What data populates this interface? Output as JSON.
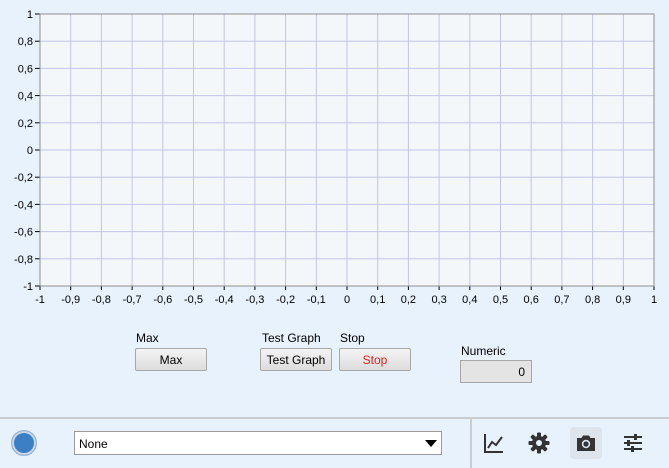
{
  "chart_data": {
    "type": "line",
    "title": "",
    "xlabel": "",
    "ylabel": "",
    "xlim": [
      -1,
      1
    ],
    "ylim": [
      -1,
      1
    ],
    "grid": true,
    "x_ticks": [
      "-1",
      "-0,9",
      "-0,8",
      "-0,7",
      "-0,6",
      "-0,5",
      "-0,4",
      "-0,3",
      "-0,2",
      "-0,1",
      "0",
      "0,1",
      "0,2",
      "0,3",
      "0,4",
      "0,5",
      "0,6",
      "0,7",
      "0,8",
      "0,9",
      "1"
    ],
    "y_ticks": [
      "1",
      "0,8",
      "0,6",
      "0,4",
      "0,2",
      "0",
      "-0,2",
      "-0,4",
      "-0,6",
      "-0,8",
      "-1"
    ],
    "series": [],
    "colors": {
      "plot_bg": "#f3f7fa",
      "grid": "#c2c5e8",
      "axis": "#8f8f8f"
    }
  },
  "controls": {
    "max": {
      "label": "Max",
      "button": "Max"
    },
    "test_graph": {
      "label": "Test Graph",
      "button": "Test Graph"
    },
    "stop": {
      "label": "Stop",
      "button": "Stop",
      "color": "#e02020"
    },
    "numeric": {
      "label": "Numeric",
      "value": "0"
    }
  },
  "bottom_bar": {
    "status_color": "#3d7fc4",
    "select_value": "None",
    "tools": [
      "graph-icon",
      "gear-icon",
      "camera-icon",
      "sliders-icon"
    ]
  }
}
